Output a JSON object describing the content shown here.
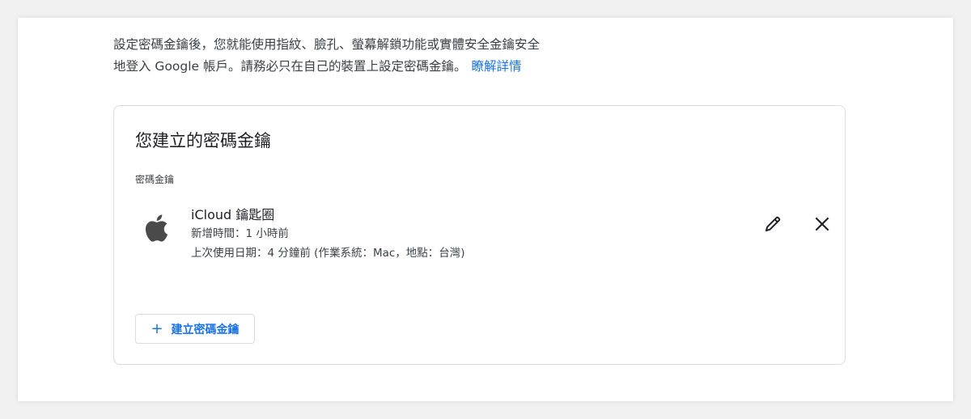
{
  "intro": {
    "line1": "設定密碼金鑰後，您就能使用指紋、臉孔、螢幕解鎖功能或實體安全金鑰安全",
    "line2": "地登入 Google 帳戶。請務必只在自己的裝置上設定密碼金鑰。",
    "learn_more": "瞭解詳情"
  },
  "card": {
    "title": "您建立的密碼金鑰",
    "section_label": "密碼金鑰",
    "passkey": {
      "icon": "apple-icon",
      "name": "iCloud 鑰匙圈",
      "created": "新增時間：1 小時前",
      "last_used": "上次使用日期：4 分鐘前 (作業系統：Mac，地點：台灣)"
    },
    "actions": {
      "edit_icon": "pencil-icon",
      "delete_icon": "close-icon"
    },
    "create_button": {
      "icon": "plus-icon",
      "plus": "+",
      "label": "建立密碼金鑰"
    }
  },
  "colors": {
    "accent": "#1a73e8",
    "text_primary": "#202124",
    "text_secondary": "#3c4043",
    "border": "#dadce0"
  }
}
